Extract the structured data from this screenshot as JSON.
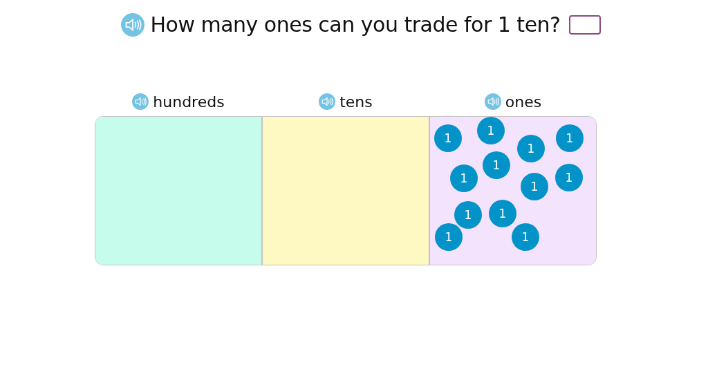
{
  "question": {
    "text": "How many ones can you trade for 1 ten?"
  },
  "place_value_chart": {
    "columns": [
      {
        "label": "hundreds",
        "color": "#c5fcec"
      },
      {
        "label": "tens",
        "color": "#fef9c2"
      },
      {
        "label": "ones",
        "color": "#f4e3fd",
        "disks": [
          "1",
          "1",
          "1",
          "1",
          "1",
          "1",
          "1",
          "1",
          "1",
          "1",
          "1",
          "1"
        ]
      }
    ]
  }
}
